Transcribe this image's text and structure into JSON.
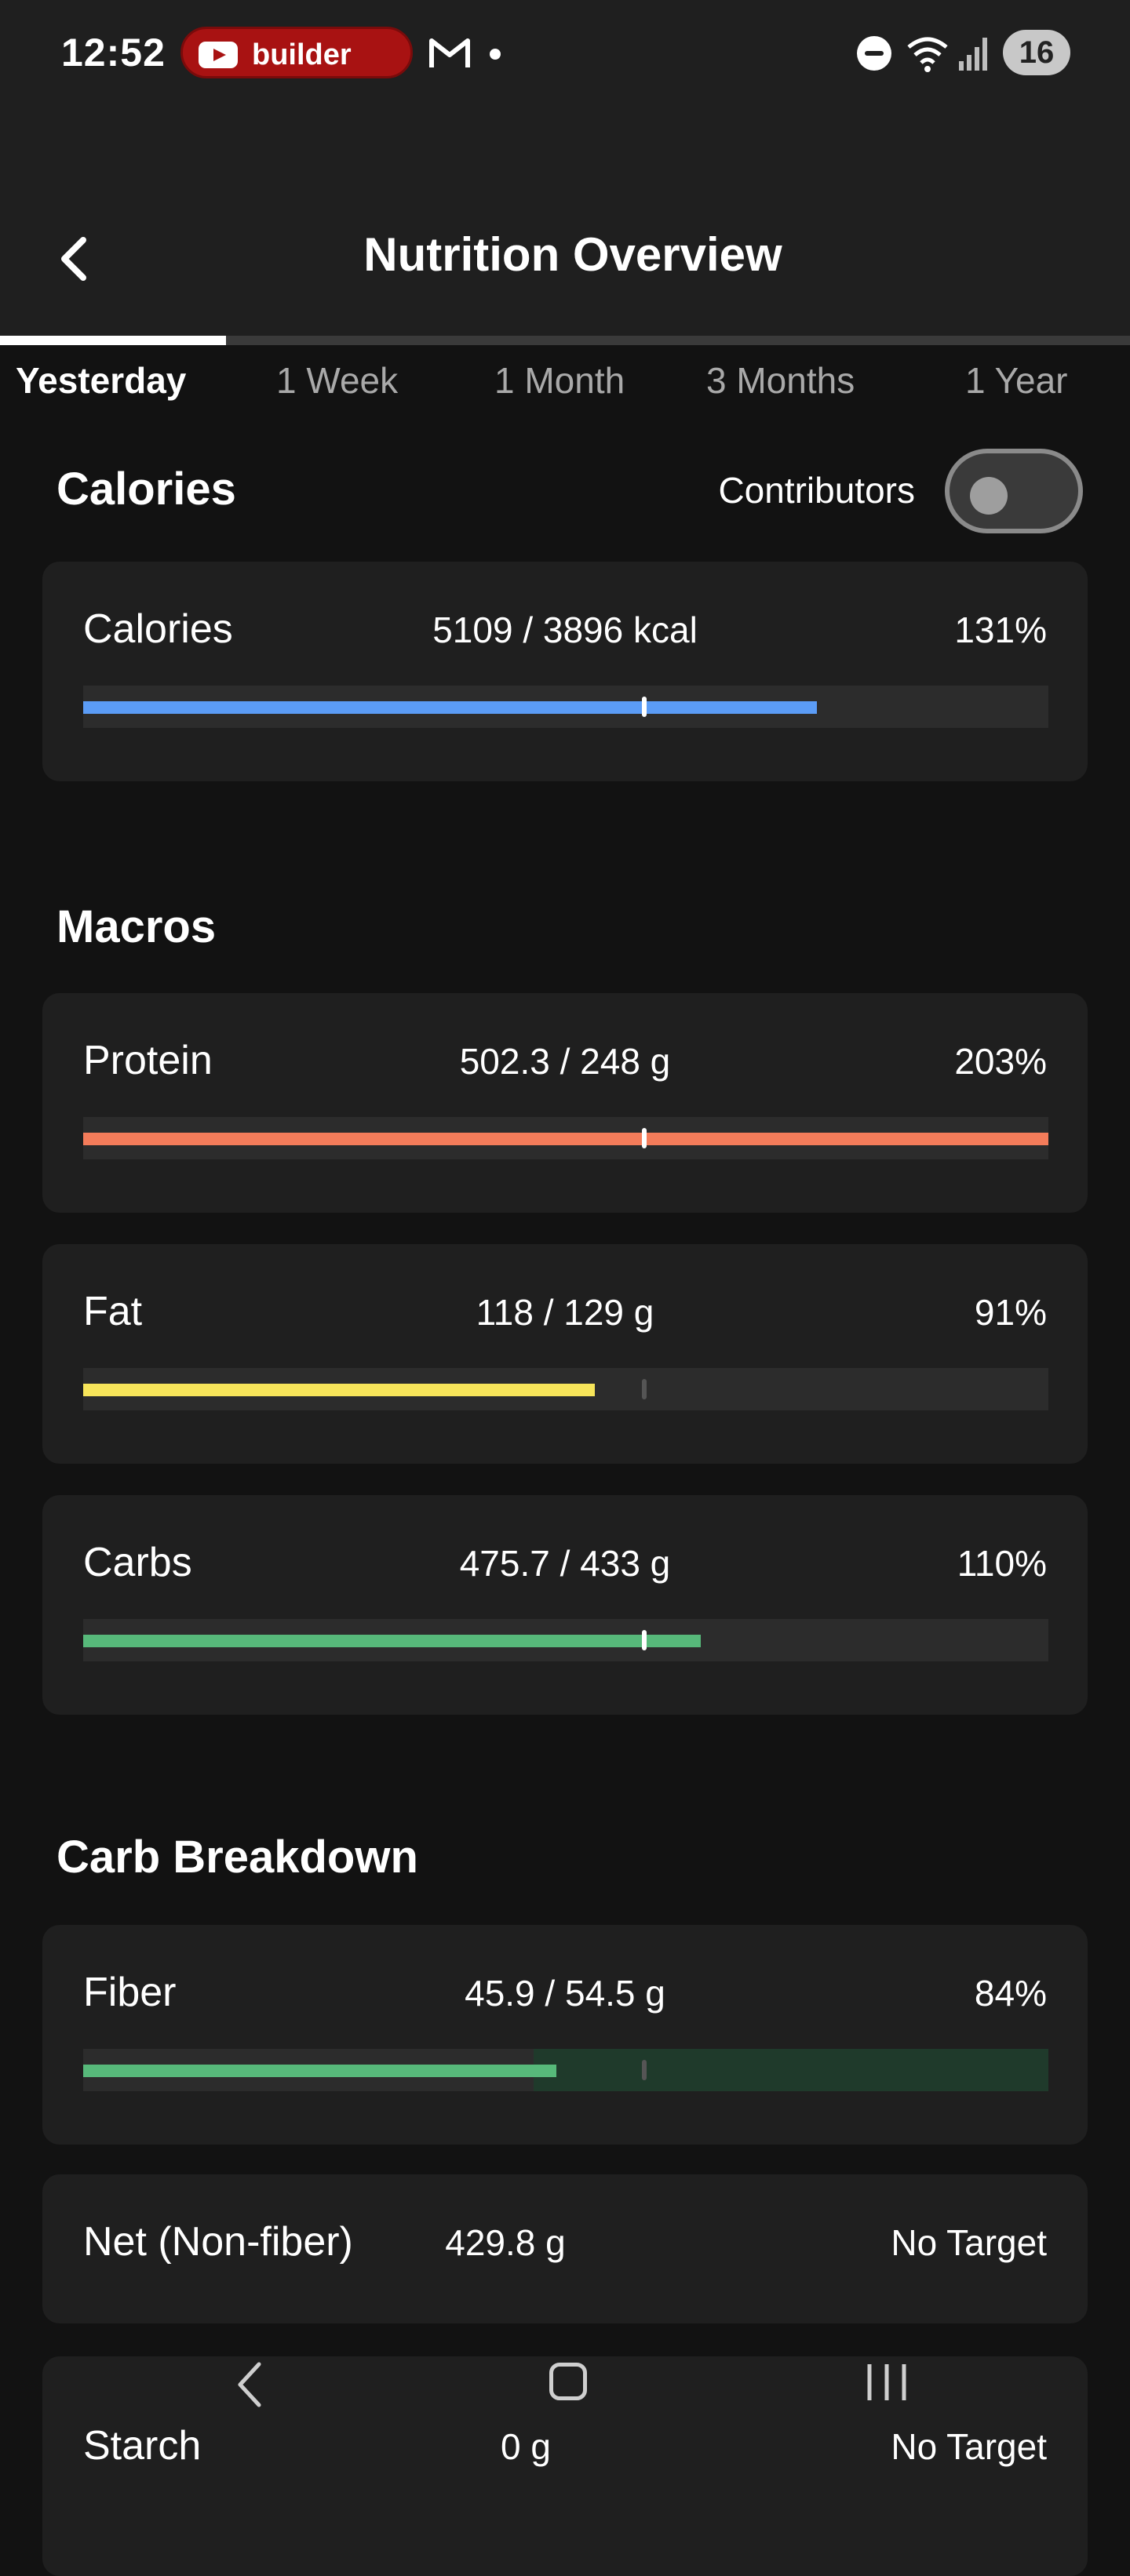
{
  "status_bar": {
    "time": "12:52",
    "notification_pill": "builder",
    "battery": "16",
    "icons": [
      "youtube-icon",
      "gmail-icon",
      "dot-icon",
      "dnd-icon",
      "wifi-icon",
      "signal-icon",
      "battery-icon"
    ]
  },
  "header": {
    "title": "Nutrition Overview",
    "back_icon": "chevron-left-icon"
  },
  "tabs": [
    {
      "label": "Yesterday",
      "active": true
    },
    {
      "label": "1 Week",
      "active": false
    },
    {
      "label": "1 Month",
      "active": false
    },
    {
      "label": "3 Months",
      "active": false
    },
    {
      "label": "1 Year",
      "active": false
    }
  ],
  "calories_section": {
    "title": "Calories",
    "contributors_label": "Contributors",
    "contributors_on": false,
    "card": {
      "name": "Calories",
      "value": "5109 / 3896 kcal",
      "percent": "131%",
      "fill_fraction": 0.76,
      "color": "#5b9cf6"
    }
  },
  "macros_section": {
    "title": "Macros",
    "items": [
      {
        "name": "Protein",
        "value": "502.3 / 248 g",
        "percent": "203%",
        "fill_fraction": 1.0,
        "color": "#f47c5a"
      },
      {
        "name": "Fat",
        "value": "118 / 129 g",
        "percent": "91%",
        "fill_fraction": 0.53,
        "color": "#f7e55a"
      },
      {
        "name": "Carbs",
        "value": "475.7 / 433 g",
        "percent": "110%",
        "fill_fraction": 0.64,
        "color": "#57b97a"
      }
    ]
  },
  "carb_breakdown_section": {
    "title": "Carb Breakdown",
    "fiber": {
      "name": "Fiber",
      "value": "45.9 / 54.5 g",
      "percent": "84%",
      "fill_fraction": 0.49,
      "color": "#57b97a"
    },
    "net": {
      "name": "Net (Non-fiber)",
      "value": "429.8 g",
      "target": "No Target"
    },
    "starch": {
      "name": "Starch",
      "value": "0 g",
      "target": "No Target"
    }
  },
  "nav_bar": {
    "icons": [
      "back-nav-icon",
      "home-nav-icon",
      "recent-apps-icon"
    ]
  }
}
